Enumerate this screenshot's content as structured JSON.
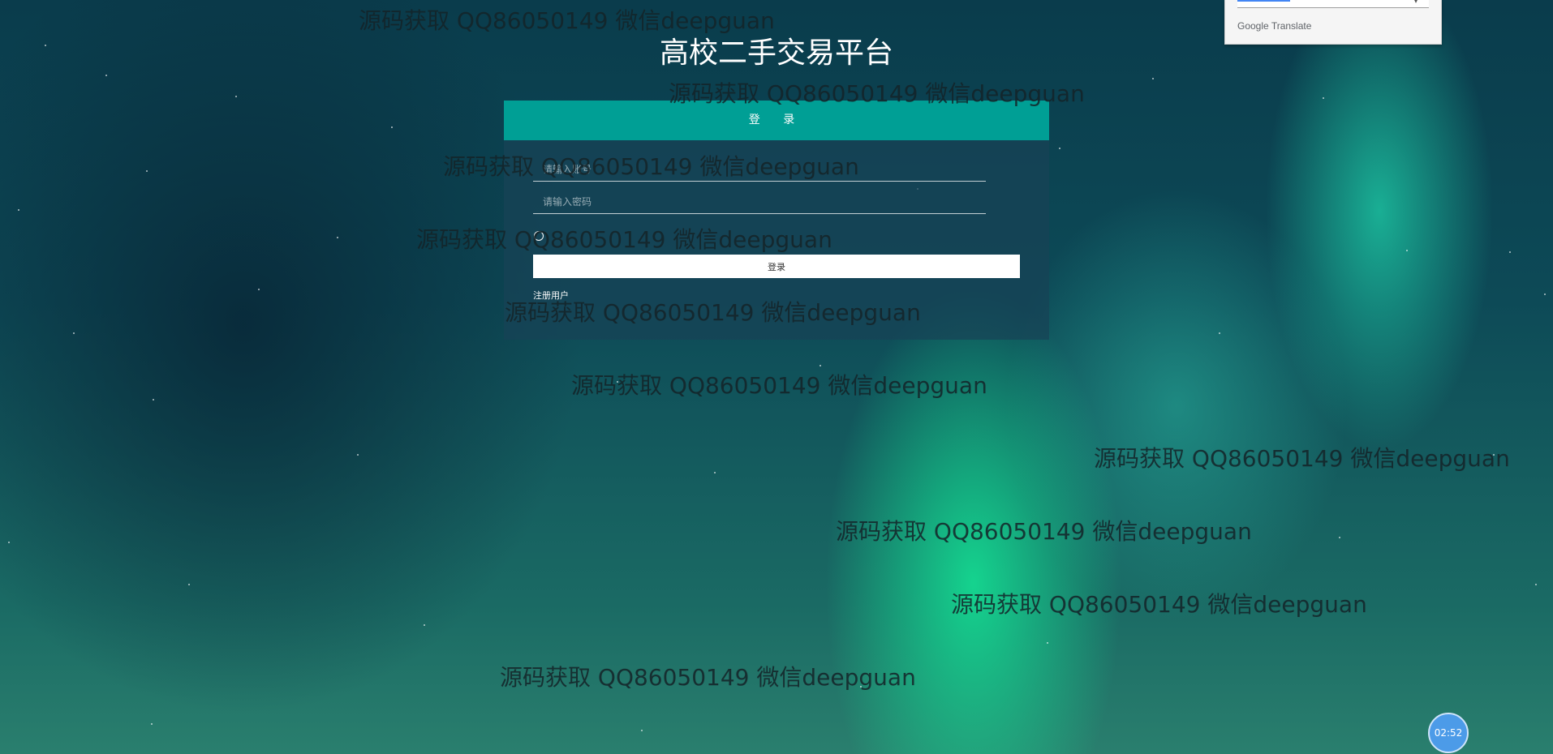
{
  "app": {
    "title": "高校二手交易平台"
  },
  "login": {
    "header": "登 录",
    "account_placeholder": "请输入账号",
    "password_placeholder": "请输入密码",
    "remember_label": "",
    "submit_label": "登录",
    "register_link": "注册用户"
  },
  "watermark": {
    "text": "源码获取 QQ86050149 微信deepguan"
  },
  "translate_popup": {
    "brand": "Google",
    "label": "Translate"
  },
  "timer": {
    "value": "02:52"
  },
  "colors": {
    "header_teal": "#009f95",
    "panel_bg": "#184256",
    "timer_blue": "#4c9be8"
  }
}
